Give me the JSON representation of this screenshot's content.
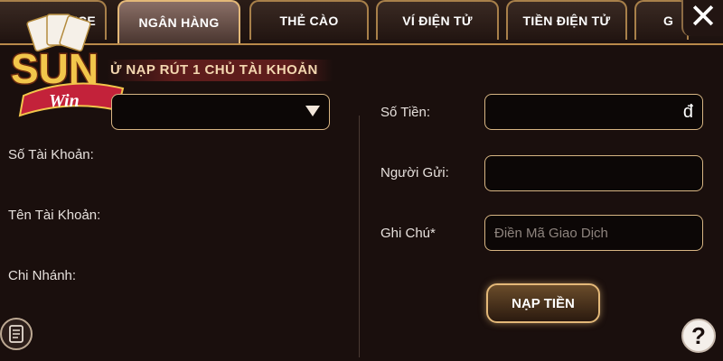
{
  "tabs": [
    {
      "label": "NICE",
      "active": false
    },
    {
      "label": "NGÂN HÀNG",
      "active": true
    },
    {
      "label": "THẺ CÀO",
      "active": false
    },
    {
      "label": "VÍ ĐIỆN TỬ",
      "active": false
    },
    {
      "label": "TIỀN ĐIỆN TỬ",
      "active": false
    },
    {
      "label": "G",
      "active": false
    }
  ],
  "close_label": "✕",
  "logo": {
    "line1": "SUN",
    "line2": "Win"
  },
  "subtitle": "Ử NẠP RÚT 1 CHỦ TÀI KHOẢN",
  "left_form": {
    "account_number_label": "Số Tài Khoản:",
    "account_name_label": "Tên Tài Khoản:",
    "branch_label": "Chi Nhánh:"
  },
  "right_form": {
    "amount_label": "Số Tiền:",
    "amount_currency": "đ",
    "sender_label": "Người Gửi:",
    "note_label": "Ghi Chú*",
    "note_placeholder": "Điền Mã Giao Dịch"
  },
  "submit_label": "NẠP TIỀN",
  "help_label": "?",
  "colors": {
    "gold_border": "#d7b583",
    "background": "#1a0f0d",
    "active_tab": "#8a6f66"
  }
}
